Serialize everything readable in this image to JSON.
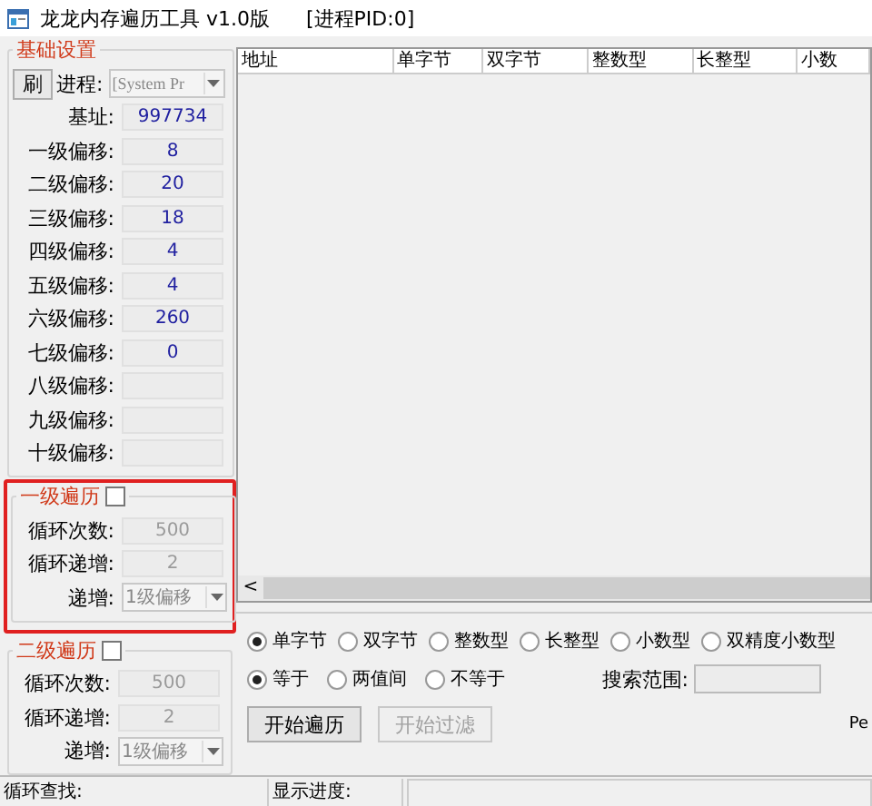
{
  "window": {
    "title": "龙龙内存遍历工具 v1.0版",
    "pid": "[进程PID:0]"
  },
  "basic_settings": {
    "title": "基础设置",
    "refresh_button": "刷",
    "process_label": "进程:",
    "process_value": "[System Pr",
    "fields": [
      {
        "label": "基址:",
        "value": "997734"
      },
      {
        "label": "一级偏移:",
        "value": "8"
      },
      {
        "label": "二级偏移:",
        "value": "20"
      },
      {
        "label": "三级偏移:",
        "value": "18"
      },
      {
        "label": "四级偏移:",
        "value": "4"
      },
      {
        "label": "五级偏移:",
        "value": "4"
      },
      {
        "label": "六级偏移:",
        "value": "260"
      },
      {
        "label": "七级偏移:",
        "value": "0"
      },
      {
        "label": "八级偏移:"
      },
      {
        "label": "九级偏移:"
      },
      {
        "label": "十级偏移:"
      }
    ]
  },
  "traversals": [
    {
      "title": "一级遍历",
      "checked": false,
      "highlighted": true,
      "disabled": true,
      "fields": [
        {
          "label": "循环次数:",
          "value": "500"
        },
        {
          "label": "循环递增:",
          "value": "2"
        }
      ],
      "step_label": "递增:",
      "step_value": "1级偏移"
    },
    {
      "title": "二级遍历",
      "checked": false,
      "highlighted": false,
      "disabled": true,
      "fields": [
        {
          "label": "循环次数:",
          "value": "500"
        },
        {
          "label": "循环递增:",
          "value": "2"
        }
      ],
      "step_label": "递增:",
      "step_value": "1级偏移"
    }
  ],
  "table": {
    "columns": [
      "地址",
      "单字节",
      "双字节",
      "整数型",
      "长整型",
      "小数"
    ],
    "scroll_left": "<"
  },
  "search": {
    "data_types": [
      {
        "label": "单字节",
        "selected": true
      },
      {
        "label": "双字节",
        "selected": false
      },
      {
        "label": "整数型",
        "selected": false
      },
      {
        "label": "长整型",
        "selected": false
      },
      {
        "label": "小数型",
        "selected": false
      },
      {
        "label": "双精度小数型",
        "selected": false
      }
    ],
    "compare": [
      {
        "label": "等于",
        "selected": true
      },
      {
        "label": "两值间",
        "selected": false
      },
      {
        "label": "不等于",
        "selected": false
      }
    ],
    "range_label": "搜索范围:",
    "buttons": [
      {
        "label": "开始遍历",
        "disabled": false
      },
      {
        "label": "开始过滤",
        "disabled": true
      }
    ],
    "cut_label": "Pe"
  },
  "status_bar": [
    "循环查找:",
    "显示进度:"
  ]
}
